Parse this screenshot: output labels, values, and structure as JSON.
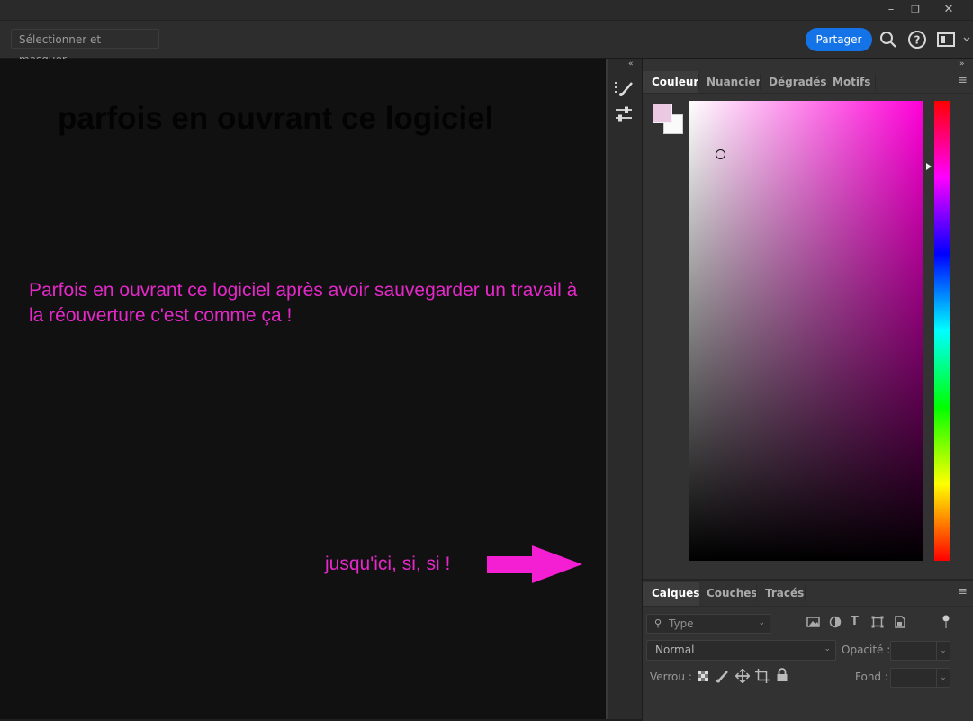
{
  "window": {
    "minimize_glyph": "–",
    "restore_glyph": "❐",
    "close_glyph": "✕"
  },
  "options_bar": {
    "select_mask_label": "Sélectionner et masquer...",
    "share_label": "Partager",
    "icons": [
      "search-icon",
      "help-icon",
      "workspace-icon"
    ]
  },
  "canvas": {
    "heading": "parfois en ouvrant ce logiciel",
    "paragraph": "Parfois en ouvrant ce logiciel après avoir sauvegarder un travail à la réouverture  c'est comme ça !",
    "note": "jusqu'ici, si, si !",
    "annotation_color": "#e528c9",
    "arrow_color": "#f41ed3"
  },
  "color_panel": {
    "tabs": [
      "Couleur",
      "Nuancier",
      "Dégradés",
      "Motifs"
    ],
    "active_tab": "Couleur",
    "foreground_color": "#ecc9e2",
    "background_color": "#fafafa",
    "hue_color": "#ff00d8"
  },
  "layers_panel": {
    "tabs": [
      "Calques",
      "Couches",
      "Tracés"
    ],
    "active_tab": "Calques",
    "filter_placeholder": "Type",
    "blend_mode": "Normal",
    "opacity_label": "Opacité :",
    "lock_label": "Verrou :",
    "fill_label": "Fond :"
  }
}
